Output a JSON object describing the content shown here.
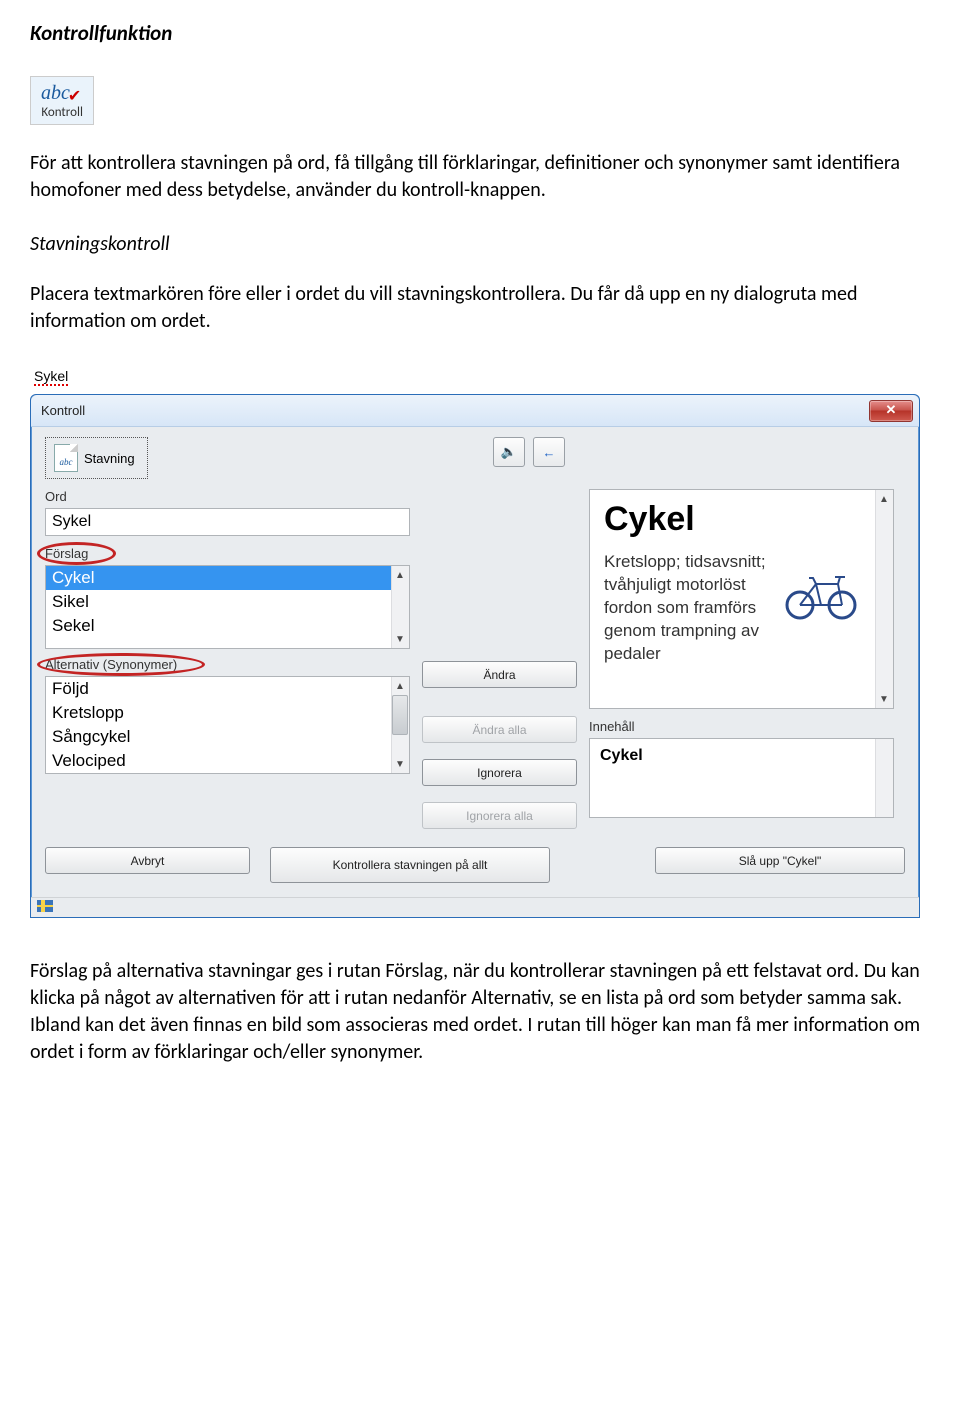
{
  "doc": {
    "heading": "Kontrollfunktion",
    "icon_label": "Kontroll",
    "icon_abc": "abc",
    "para1": "För att kontrollera stavningen på ord, få tillgång till förklaringar, definitioner och synonymer samt identifiera homofoner med dess betydelse, använder du kontroll-knappen.",
    "subheading": "Stavningskontroll",
    "para2": "Placera textmarkören före eller i ordet du vill stavningskontrollera. Du får då upp en ny dialogruta med information om ordet.",
    "misspelled_word": "Sykel",
    "para3": "Förslag på alternativa stavningar ges i rutan Förslag, när du kontrollerar stavningen på ett felstavat ord. Du kan klicka på något av alternativen för att i rutan nedanför Alternativ, se en lista på ord som betyder samma sak. Ibland kan det även finnas en bild som associeras med ordet. I rutan till höger kan man få mer information om ordet i form av förklaringar och/eller synonymer."
  },
  "dialog": {
    "title": "Kontroll",
    "tab_label": "Stavning",
    "ord_label": "Ord",
    "ord_value": "Sykel",
    "forslag_label": "Förslag",
    "forslag_items": [
      "Cykel",
      "Sikel",
      "Sekel"
    ],
    "alternativ_label": "Alternativ (Synonymer)",
    "alternativ_items": [
      "Följd",
      "Kretslopp",
      "Sångcykel",
      "Velociped"
    ],
    "buttons": {
      "andra": "Ändra",
      "andra_alla": "Ändra alla",
      "ignorera": "Ignorera",
      "ignorera_alla": "Ignorera alla",
      "avbryt": "Avbryt",
      "kontrollera": "Kontrollera stavningen på allt",
      "slaupp": "Slå upp \"Cykel\""
    },
    "right": {
      "word": "Cykel",
      "definition": "Kretslopp; tidsavsnitt; tvåhjuligt motorlöst fordon som framförs genom trampning av pedaler",
      "innehall_label": "Innehåll",
      "innehall_value": "Cykel"
    }
  }
}
